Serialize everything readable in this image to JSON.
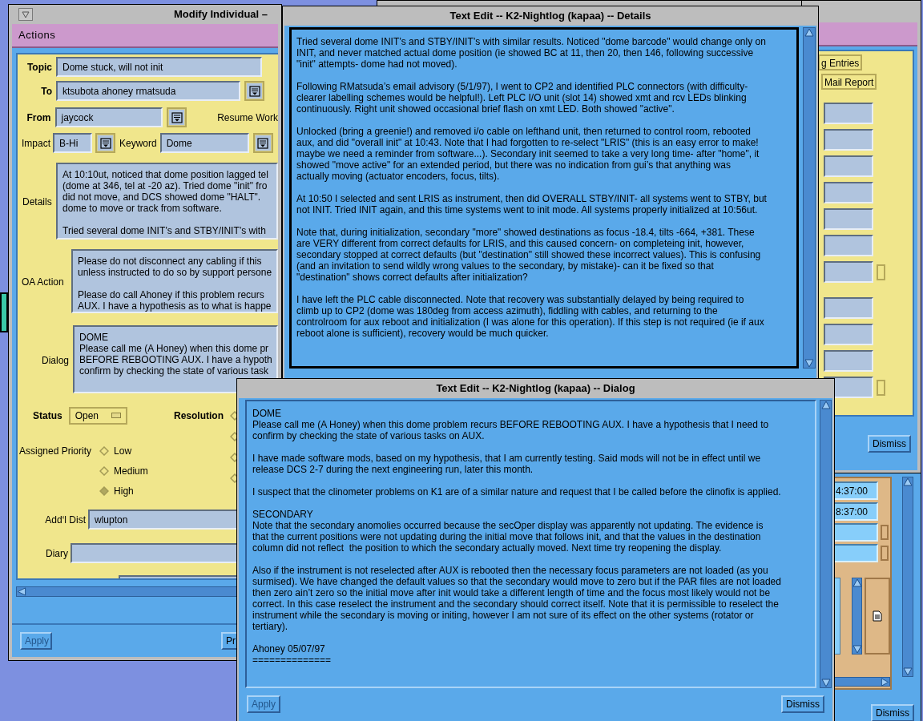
{
  "modify_window": {
    "title": "Modify Individual –",
    "menu": [
      "Actions"
    ],
    "topic": {
      "label": "Topic",
      "value": "Dome stuck, will not init"
    },
    "to": {
      "label": "To",
      "value": "ktsubota ahoney rmatsuda"
    },
    "from": {
      "label": "From",
      "value": "jaycock"
    },
    "resume_work": "Resume Work",
    "impact": {
      "label": "Impact",
      "value": "B-Hi"
    },
    "keyword": {
      "label": "Keyword",
      "value": "Dome"
    },
    "details": {
      "label": "Details",
      "paragraphs": [
        [
          "At 10:10ut, noticed that dome position lagged tel",
          "(dome at 346, tel at -20 az). Tried dome \"init\" fro",
          "did not move, and DCS showed dome \"HALT\".",
          "dome to move or track from software."
        ],
        [
          "Tried several dome INIT’s and STBY/INIT’s with"
        ]
      ]
    },
    "oa_action": {
      "label": "OA Action",
      "paragraphs": [
        [
          "Please do not disconnect any cabling if this",
          "unless instructed to do so by support persone"
        ],
        [
          "Please do call Ahoney if this problem recurs",
          "AUX. I have a hypothesis as to what is happe"
        ]
      ]
    },
    "dialog": {
      "label": "Dialog",
      "paragraphs": [
        [
          "DOME",
          "Please call me (A Honey) when this dome pr",
          "BEFORE REBOOTING AUX. I have a hypoth",
          "confirm by checking the state of various task"
        ]
      ]
    },
    "status": {
      "label": "Status",
      "value": "Open"
    },
    "resolution": {
      "label": "Resolution",
      "options": [
        {
          "selected": false
        },
        {
          "selected": false
        },
        {
          "selected": false
        },
        {
          "selected": false
        }
      ]
    },
    "priority": {
      "label": "Assigned Priority",
      "options": [
        {
          "label": "Low",
          "selected": false
        },
        {
          "label": "Medium",
          "selected": false
        },
        {
          "label": "High",
          "selected": true
        }
      ]
    },
    "addl_dist": {
      "label": "Add‘l Dist",
      "value": "wlupton"
    },
    "diary": {
      "label": "Diary"
    },
    "buttons": [
      {
        "label": "Apply",
        "disabled": true
      },
      {
        "label": "Pr",
        "disabled": false
      }
    ]
  },
  "details_window": {
    "title": "Text Edit -- K2-Nightlog (kapaa) -- Details",
    "paragraphs": [
      [
        "Tried several dome INIT’s and STBY/INIT’s with similar results. Noticed \"dome barcode\" would change only on",
        "INIT, and never matched actual dome position (ie showed BC at 11, then 20, then 146, following successive",
        "\"init\" attempts- dome had not moved)."
      ],
      [
        "Following RMatsuda’s email advisory (5/1/97), I went to CP2 and identified PLC connectors (with difficulty-",
        "clearer labelling schemes would be helpful!). Left PLC I/O unit (slot 14) showed xmt and rcv LEDs blinking",
        "continuously. Right unit showed occasional brief flash on xmt LED. Both showed \"active\"."
      ],
      [
        "Unlocked (bring a greenie!) and removed i/o cable on lefthand unit, then returned to control room, rebooted",
        "aux, and did \"overall init\" at 10:43. Note that I had forgotten to re-select \"LRIS\" (this is an easy error to make!",
        "maybe we need a reminder from software...). Secondary init seemed to take a very long time- after \"home\", it",
        "showed \"move active\" for an extended period, but there was no indication from gui’s that anything was",
        "actually moving (actuator encoders, focus, tilts)."
      ],
      [
        "At 10:50 I selected and sent LRIS as instrument, then did OVERALL STBY/INIT- all systems went to STBY, but",
        "not INIT. Tried INIT again, and this time systems went to init mode. All systems properly initialized at 10:56ut."
      ],
      [
        "Note that, during initialization, secondary \"more\" showed destinations as focus -18.4, tilts -664, +381. These",
        "are VERY different from correct defaults for LRIS, and this caused concern- on completeing init, however,",
        "secondary stopped at correct defaults (but \"destination\" still showed these incorrect values). This is confusing",
        "(and an invitation to send wildly wrong values to the secondary, by mistake)- can it be fixed so that",
        "\"destination\" shows correct defaults after initialization?"
      ],
      [
        "I have left the PLC cable disconnected. Note that recovery was substantially delayed by being required to",
        "climb up to CP2 (dome was 180deg from access azimuth), fiddling with cables, and returning to the",
        "controlroom for aux reboot and initialization (I was alone for this operation). If this step is not required (ie if aux",
        "reboot alone is sufficient), recovery would be much quicker."
      ]
    ]
  },
  "entries_window": {
    "buttons": [
      "g Entries",
      "Mail Report"
    ],
    "fields": [
      {
        "kind": "plain"
      },
      {
        "kind": "plain"
      },
      {
        "kind": "plain"
      },
      {
        "kind": "plain"
      },
      {
        "kind": "plain"
      },
      {
        "kind": "plain"
      },
      {
        "kind": "toggle"
      },
      {
        "kind": "gap"
      },
      {
        "kind": "plain"
      },
      {
        "kind": "plain"
      },
      {
        "kind": "plain"
      },
      {
        "kind": "toggle"
      }
    ],
    "dismiss": "Dismiss"
  },
  "times_window": {
    "fields": [
      {
        "kind": "plain",
        "value": "4:37:00"
      },
      {
        "kind": "plain",
        "value": "8:37:00"
      },
      {
        "kind": "toggle"
      },
      {
        "kind": "toggle"
      }
    ],
    "dismiss": "Dismiss"
  },
  "dialog_window": {
    "title": "Text Edit -- K2-Nightlog (kapaa) -- Dialog",
    "paragraphs": [
      [
        "DOME",
        "Please call me (A Honey) when this dome problem recurs BEFORE REBOOTING AUX. I have a hypothesis that I need to",
        "confirm by checking the state of various tasks on AUX."
      ],
      [
        "I have made software mods, based on my hypothesis, that I am currently testing. Said mods will not be in effect until we",
        "release DCS 2-7 during the next engineering run, later this month."
      ],
      [
        "I suspect that the clinometer problems on K1 are of a similar nature and request that I be called before the clinofix is applied."
      ],
      [
        "SECONDARY",
        "Note that the secondary anomolies occurred because the secOper display was apparently not updating. The evidence is",
        "that the current positions were not updating during the initial move that follows init, and that the values in the destination",
        "column did not reflect  the position to which the secondary actually moved. Next time try reopening the display."
      ],
      [
        "Also if the instrument is not reselected after AUX is rebooted then the necessary focus parameters are not loaded (as you",
        "surmised). We have changed the default values so that the secondary would move to zero but if the PAR files are not loaded",
        "then zero ain’t zero so the initial move after init would take a different length of time and the focus most likely would not be",
        "correct. In this case reselect the instrument and the secondary should correct itself. Note that it is permissible to reselect the",
        "instrument while the secondary is moving or initing, however I am not sure of its effect on the other systems (rotator or",
        "tertiary)."
      ],
      [
        "Ahoney 05/07/97",
        "=============="
      ]
    ],
    "buttons": [
      {
        "label": "Apply",
        "disabled": true
      },
      {
        "label": "Dismiss",
        "disabled": false
      }
    ]
  }
}
